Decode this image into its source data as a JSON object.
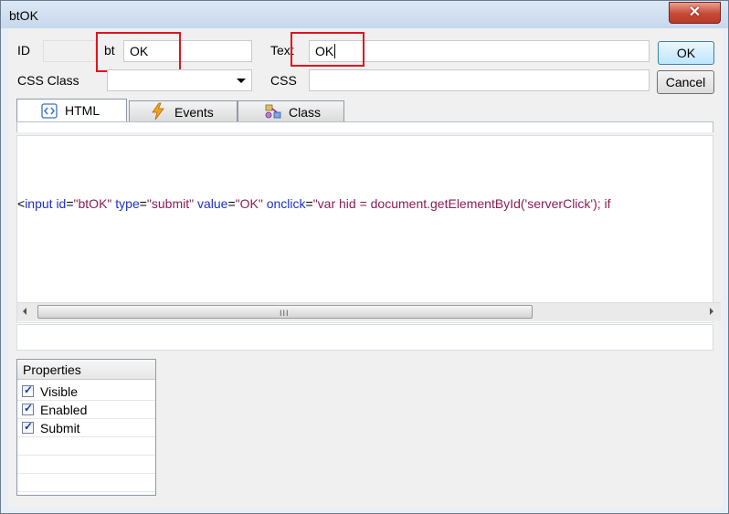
{
  "window": {
    "title": "btOK"
  },
  "fields": {
    "id_label": "ID",
    "id_prefix": "bt",
    "id_value": "OK",
    "text_label": "Text",
    "text_value": "OK",
    "css_class_label": "CSS Class",
    "css_class_value": "",
    "css_label": "CSS",
    "css_value": ""
  },
  "buttons": {
    "ok": "OK",
    "cancel": "Cancel"
  },
  "tabs": [
    {
      "label": "HTML",
      "icon": "html-code-icon",
      "active": true
    },
    {
      "label": "Events",
      "icon": "lightning-icon",
      "active": false
    },
    {
      "label": "Class",
      "icon": "class-diagram-icon",
      "active": false
    }
  ],
  "code": {
    "open": "<",
    "tag": "input",
    "attr1": "id",
    "val1": "\"btOK\"",
    "attr2": "type",
    "val2": "\"submit\"",
    "attr3": "value",
    "val3": "\"OK\"",
    "attr4": "onclick",
    "val4": "\"var hid = document.getElementById('serverClick'); if"
  },
  "scrollbar": {
    "grip": "III"
  },
  "properties": {
    "header": "Properties",
    "items": [
      {
        "label": "Visible",
        "checked": true
      },
      {
        "label": "Enabled",
        "checked": true
      },
      {
        "label": "Submit",
        "checked": true
      }
    ]
  },
  "colors": {
    "highlight": "#e0131f",
    "tag": "#1b2fd1",
    "value": "#8a1d55"
  }
}
